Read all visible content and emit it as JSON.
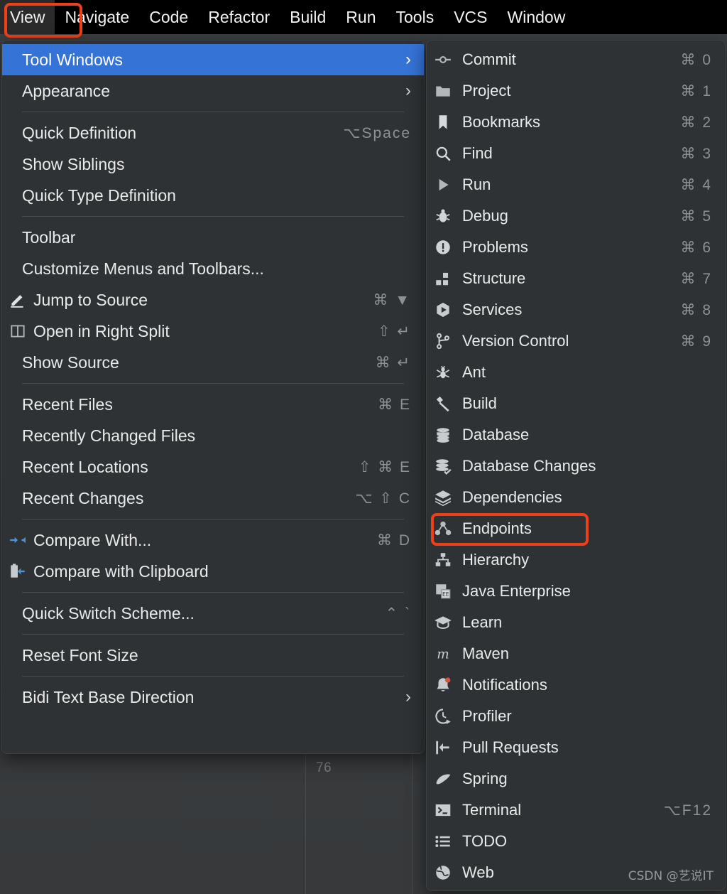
{
  "app": {
    "theme_bg": "#3c3f41",
    "panel_bg": "#2f3234",
    "accent_highlight": "#3573d6",
    "annotation_color": "#f0401a",
    "editor_line_number": "76",
    "watermark": "CSDN @艺说IT"
  },
  "menubar": {
    "items": [
      {
        "label": "View",
        "active": true
      },
      {
        "label": "Navigate",
        "active": false
      },
      {
        "label": "Code",
        "active": false
      },
      {
        "label": "Refactor",
        "active": false
      },
      {
        "label": "Build",
        "active": false
      },
      {
        "label": "Run",
        "active": false
      },
      {
        "label": "Tools",
        "active": false
      },
      {
        "label": "VCS",
        "active": false
      },
      {
        "label": "Window",
        "active": false
      }
    ]
  },
  "view_menu": {
    "groups": [
      {
        "items": [
          {
            "label": "Tool Windows",
            "shortcut": "",
            "submenu": true,
            "selected": true,
            "icon": ""
          },
          {
            "label": "Appearance",
            "shortcut": "",
            "submenu": true,
            "selected": false,
            "icon": ""
          }
        ]
      },
      {
        "items": [
          {
            "label": "Quick Definition",
            "shortcut": "⌥Space",
            "submenu": false,
            "selected": false,
            "icon": ""
          },
          {
            "label": "Show Siblings",
            "shortcut": "",
            "submenu": false,
            "selected": false,
            "icon": ""
          },
          {
            "label": "Quick Type Definition",
            "shortcut": "",
            "submenu": false,
            "selected": false,
            "icon": ""
          }
        ]
      },
      {
        "items": [
          {
            "label": "Toolbar",
            "shortcut": "",
            "submenu": false,
            "selected": false,
            "icon": ""
          },
          {
            "label": "Customize Menus and Toolbars...",
            "shortcut": "",
            "submenu": false,
            "selected": false,
            "icon": ""
          },
          {
            "label": "Jump to Source",
            "shortcut": "⌘ ▼",
            "submenu": false,
            "selected": false,
            "icon": "pencil-icon"
          },
          {
            "label": "Open in Right Split",
            "shortcut": "⇧ ↵",
            "submenu": false,
            "selected": false,
            "icon": "split-panes-icon"
          },
          {
            "label": "Show Source",
            "shortcut": "⌘ ↵",
            "submenu": false,
            "selected": false,
            "icon": ""
          }
        ]
      },
      {
        "items": [
          {
            "label": "Recent Files",
            "shortcut": "⌘ E",
            "submenu": false,
            "selected": false,
            "icon": ""
          },
          {
            "label": "Recently Changed Files",
            "shortcut": "",
            "submenu": false,
            "selected": false,
            "icon": ""
          },
          {
            "label": "Recent Locations",
            "shortcut": "⇧ ⌘ E",
            "submenu": false,
            "selected": false,
            "icon": ""
          },
          {
            "label": "Recent Changes",
            "shortcut": "⌥ ⇧ C",
            "submenu": false,
            "selected": false,
            "icon": ""
          }
        ]
      },
      {
        "items": [
          {
            "label": "Compare With...",
            "shortcut": "⌘ D",
            "submenu": false,
            "selected": false,
            "icon": "compare-icon"
          },
          {
            "label": "Compare with Clipboard",
            "shortcut": "",
            "submenu": false,
            "selected": false,
            "icon": "compare-clipboard-icon"
          }
        ]
      },
      {
        "items": [
          {
            "label": "Quick Switch Scheme...",
            "shortcut": "⌃ `",
            "submenu": false,
            "selected": false,
            "icon": ""
          }
        ]
      },
      {
        "items": [
          {
            "label": "Reset Font Size",
            "shortcut": "",
            "submenu": false,
            "selected": false,
            "icon": ""
          }
        ]
      },
      {
        "items": [
          {
            "label": "Bidi Text Base Direction",
            "shortcut": "",
            "submenu": true,
            "selected": false,
            "icon": ""
          }
        ]
      }
    ]
  },
  "tool_windows_menu": {
    "highlighted_item": "Endpoints",
    "items": [
      {
        "label": "Commit",
        "shortcut": "⌘ 0",
        "icon": "commit-icon"
      },
      {
        "label": "Project",
        "shortcut": "⌘ 1",
        "icon": "folder-icon"
      },
      {
        "label": "Bookmarks",
        "shortcut": "⌘ 2",
        "icon": "bookmark-icon"
      },
      {
        "label": "Find",
        "shortcut": "⌘ 3",
        "icon": "search-icon"
      },
      {
        "label": "Run",
        "shortcut": "⌘ 4",
        "icon": "play-icon"
      },
      {
        "label": "Debug",
        "shortcut": "⌘ 5",
        "icon": "bug-icon"
      },
      {
        "label": "Problems",
        "shortcut": "⌘ 6",
        "icon": "warning-circle-icon"
      },
      {
        "label": "Structure",
        "shortcut": "⌘ 7",
        "icon": "structure-icon"
      },
      {
        "label": "Services",
        "shortcut": "⌘ 8",
        "icon": "services-icon"
      },
      {
        "label": "Version Control",
        "shortcut": "⌘ 9",
        "icon": "branch-icon"
      },
      {
        "label": "Ant",
        "shortcut": "",
        "icon": "ant-icon"
      },
      {
        "label": "Build",
        "shortcut": "",
        "icon": "hammer-icon"
      },
      {
        "label": "Database",
        "shortcut": "",
        "icon": "database-icon"
      },
      {
        "label": "Database Changes",
        "shortcut": "",
        "icon": "database-check-icon"
      },
      {
        "label": "Dependencies",
        "shortcut": "",
        "icon": "layers-icon"
      },
      {
        "label": "Endpoints",
        "shortcut": "",
        "icon": "endpoints-icon"
      },
      {
        "label": "Hierarchy",
        "shortcut": "",
        "icon": "hierarchy-icon"
      },
      {
        "label": "Java Enterprise",
        "shortcut": "",
        "icon": "java-ee-icon"
      },
      {
        "label": "Learn",
        "shortcut": "",
        "icon": "graduation-cap-icon"
      },
      {
        "label": "Maven",
        "shortcut": "",
        "icon": "maven-icon"
      },
      {
        "label": "Notifications",
        "shortcut": "",
        "icon": "bell-icon"
      },
      {
        "label": "Profiler",
        "shortcut": "",
        "icon": "profiler-icon"
      },
      {
        "label": "Pull Requests",
        "shortcut": "",
        "icon": "pull-request-icon"
      },
      {
        "label": "Spring",
        "shortcut": "",
        "icon": "spring-leaf-icon"
      },
      {
        "label": "Terminal",
        "shortcut": "⌥F12",
        "icon": "terminal-icon"
      },
      {
        "label": "TODO",
        "shortcut": "",
        "icon": "list-icon"
      },
      {
        "label": "Web",
        "shortcut": "",
        "icon": "globe-icon"
      }
    ]
  }
}
